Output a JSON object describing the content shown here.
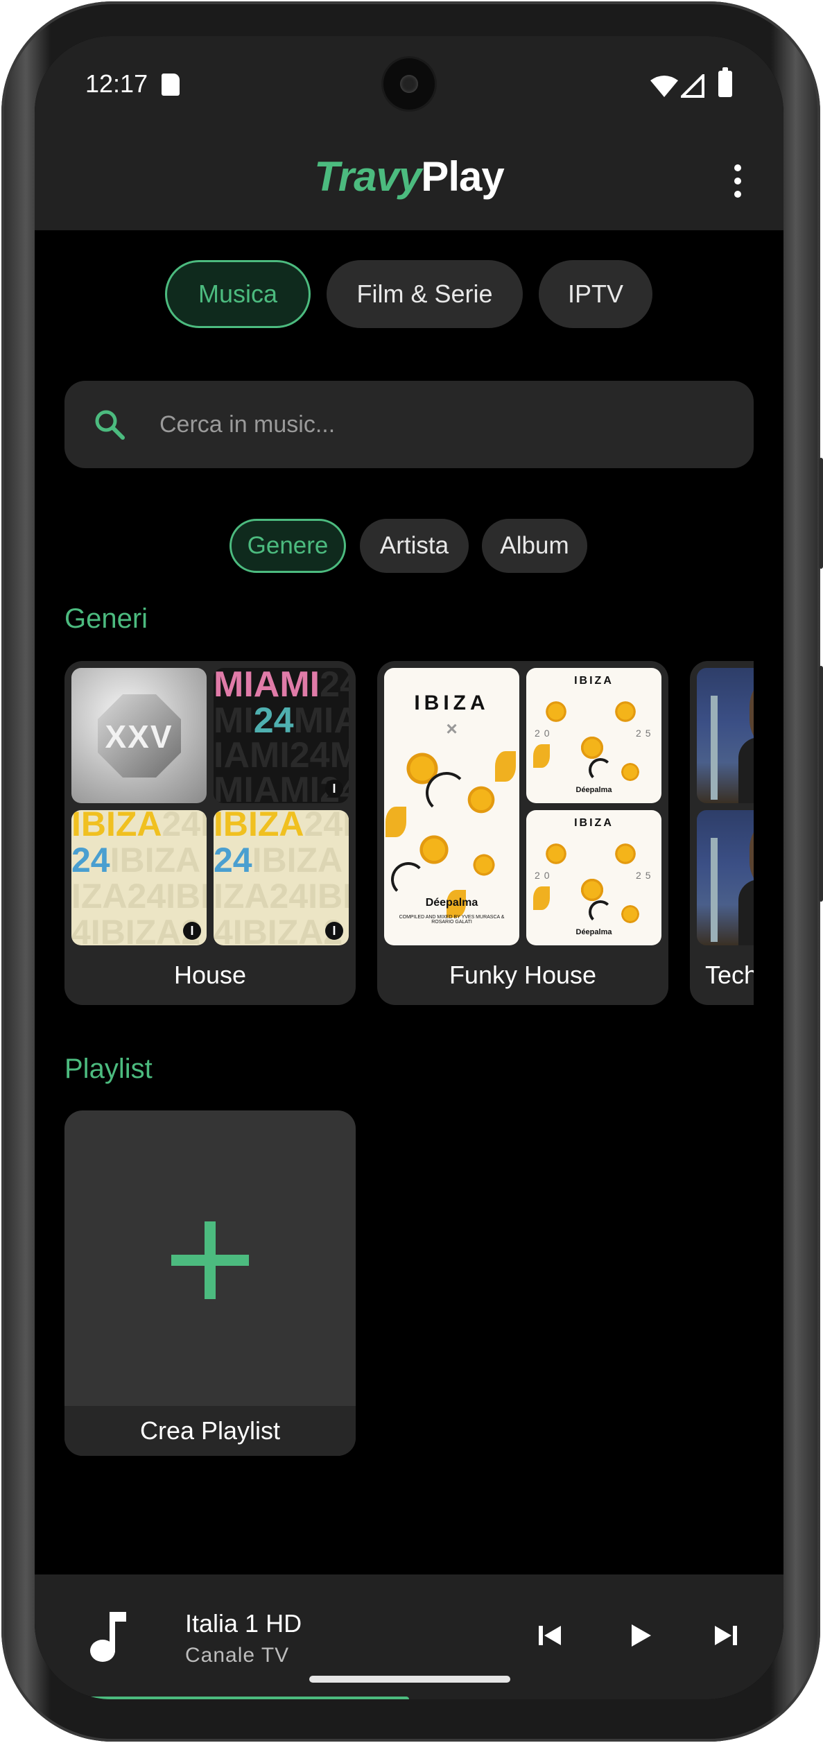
{
  "status_bar": {
    "time": "12:17"
  },
  "app": {
    "title_part1": "Travy",
    "title_part2": "Play"
  },
  "main_tabs": [
    {
      "label": "Musica",
      "active": true
    },
    {
      "label": "Film & Serie",
      "active": false
    },
    {
      "label": "IPTV",
      "active": false
    }
  ],
  "search": {
    "placeholder": "Cerca in music...",
    "value": ""
  },
  "filters": [
    {
      "label": "Genere",
      "active": true
    },
    {
      "label": "Artista",
      "active": false
    },
    {
      "label": "Album",
      "active": false
    }
  ],
  "sections": {
    "genres_title": "Generi",
    "playlist_title": "Playlist"
  },
  "genres": [
    {
      "name": "House"
    },
    {
      "name": "Funky House"
    },
    {
      "name": "Tech"
    }
  ],
  "artwork": {
    "xxv": "XXV",
    "miami_lines": [
      "MIAMI24",
      "24MIAMI",
      "IAMI24M",
      "MIAMI24"
    ],
    "miami_pink": "MIAMI",
    "miami_teal": "24",
    "ibiza_lines": [
      "IBIZA24I",
      "24IBIZA",
      "IZA24IBI",
      "4IBIZA2"
    ],
    "ibiza_yellow": "IBIZA",
    "ibiza_blue": "24",
    "deep_title": "IBIZA",
    "deep_year_left": "20",
    "deep_year_right": "25",
    "deep_logo": "Déepalma",
    "deep_credit": "COMPILED AND MIXED BY YVES MURASCA & ROSARIO GALATI",
    "badge": "I"
  },
  "playlist": {
    "create_label": "Crea Playlist"
  },
  "player": {
    "title": "Italia 1 HD",
    "subtitle": "Canale TV",
    "progress": 0.5
  },
  "colors": {
    "accent": "#4cbb7f",
    "background": "#000000",
    "surface": "#272727"
  }
}
